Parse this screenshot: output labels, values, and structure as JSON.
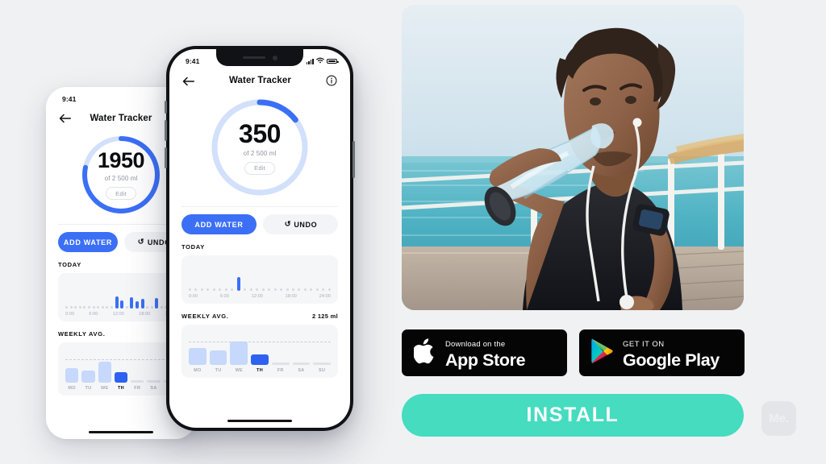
{
  "canvas": {
    "background": "#f0f1f3"
  },
  "phone_back": {
    "status": {
      "time": "9:41"
    },
    "nav": {
      "back_icon": "arrow-left-icon",
      "title": "Water Tracker"
    },
    "ring": {
      "value": "1950",
      "sub": "of 2 500 ml",
      "edit_label": "Edit",
      "percent": 78,
      "track_color": "#d2e0fb",
      "fill_color": "#3b6ff5"
    },
    "actions": {
      "primary": "ADD WATER",
      "secondary": "UNDO",
      "undo_icon": "undo-arrow-icon"
    },
    "today": {
      "title": "TODAY",
      "axis": [
        "0:00",
        "6:00",
        "12:00",
        "18:00",
        "24:00"
      ],
      "bars": [
        0,
        0,
        0,
        0,
        0,
        0,
        0,
        0,
        0,
        0,
        0,
        15,
        10,
        0,
        14,
        9,
        12,
        0,
        0,
        13,
        0,
        0,
        0,
        0
      ]
    },
    "weekly": {
      "title": "WEEKLY AVG.",
      "value": "",
      "categories": [
        "MO",
        "TU",
        "WE",
        "TH",
        "FR",
        "SA",
        "SU"
      ],
      "values": [
        46,
        38,
        66,
        32,
        7,
        7,
        7
      ],
      "active_index": 3
    }
  },
  "phone_front": {
    "status": {
      "time": "9:41",
      "signal_icon": "cellular-signal-icon",
      "wifi_icon": "wifi-icon",
      "battery_icon": "battery-icon"
    },
    "nav": {
      "back_icon": "arrow-left-icon",
      "title": "Water Tracker",
      "info_icon": "info-circle-icon"
    },
    "ring": {
      "value": "350",
      "sub": "of 2 500 ml",
      "edit_label": "Edit",
      "percent": 14,
      "track_color": "#d2e0fb",
      "fill_color": "#3b6ff5"
    },
    "actions": {
      "primary": "ADD WATER",
      "secondary": "UNDO",
      "undo_icon": "undo-arrow-icon"
    },
    "today": {
      "title": "TODAY",
      "axis": [
        "0:00",
        "6:00",
        "12:00",
        "18:00",
        "24:00"
      ],
      "dot_count": 24,
      "active_dot": 8,
      "active_height": 17
    },
    "weekly": {
      "title": "WEEKLY AVG.",
      "value": "2 125 ml",
      "categories": [
        "MO",
        "TU",
        "WE",
        "TH",
        "FR",
        "SA",
        "SU"
      ],
      "values": [
        52,
        44,
        72,
        33,
        8,
        8,
        8
      ],
      "active_index": 3,
      "avg_line": true
    }
  },
  "chart_data": [
    {
      "type": "bar",
      "title": "TODAY",
      "xlabel": "",
      "ylabel": "",
      "categories": [
        "0:00",
        "6:00",
        "12:00",
        "18:00",
        "24:00"
      ],
      "x": [
        0,
        1,
        2,
        3,
        4,
        5,
        6,
        7,
        8,
        9,
        10,
        11,
        12,
        13,
        14,
        15,
        16,
        17,
        18,
        19,
        20,
        21,
        22,
        23
      ],
      "values": [
        0,
        0,
        0,
        0,
        0,
        0,
        0,
        0,
        350,
        0,
        0,
        0,
        0,
        0,
        0,
        0,
        0,
        0,
        0,
        0,
        0,
        0,
        0,
        0
      ],
      "legend": [],
      "grid": false,
      "note": "Front phone: single intake event at ~7:00-8:00, 350 ml"
    },
    {
      "type": "bar",
      "title": "WEEKLY AVG.",
      "subtitle": "2 125 ml",
      "categories": [
        "MO",
        "TU",
        "WE",
        "TH",
        "FR",
        "SA",
        "SU"
      ],
      "values": [
        1900,
        1620,
        2550,
        1200,
        0,
        0,
        0
      ],
      "ylim": [
        0,
        2800
      ],
      "xlabel": "",
      "ylabel": "ml",
      "grid": false,
      "annotations": [
        "average line at 2 125 ml",
        "TH is current/highlighted day",
        "FR, SA, SU are future days (empty)"
      ]
    },
    {
      "type": "bar",
      "title": "TODAY (back phone)",
      "categories": [
        "0:00",
        "6:00",
        "12:00",
        "18:00"
      ],
      "x": [
        0,
        1,
        2,
        3,
        4,
        5,
        6,
        7,
        8,
        9,
        10,
        11,
        12,
        13,
        14,
        15,
        16,
        17,
        18,
        19,
        20,
        21,
        22,
        23
      ],
      "values": [
        0,
        0,
        0,
        0,
        0,
        0,
        0,
        0,
        0,
        0,
        0,
        300,
        200,
        0,
        280,
        180,
        240,
        0,
        0,
        260,
        0,
        0,
        0,
        0
      ],
      "grid": false,
      "note": "Back phone: multiple intake events through the day totalling 1950 ml"
    }
  ],
  "hero": {
    "alt_name": "man-drinking-water-photo"
  },
  "store_badges": [
    {
      "id": "app-store",
      "icon": "apple-logo-icon",
      "top": "Download on the",
      "bottom": "App Store"
    },
    {
      "id": "google-play",
      "icon": "google-play-triangle-icon",
      "top": "GET IT ON",
      "bottom": "Google Play"
    }
  ],
  "cta": {
    "install_label": "INSTALL",
    "color": "#45dcc0"
  },
  "watermark": {
    "text": "Me."
  }
}
